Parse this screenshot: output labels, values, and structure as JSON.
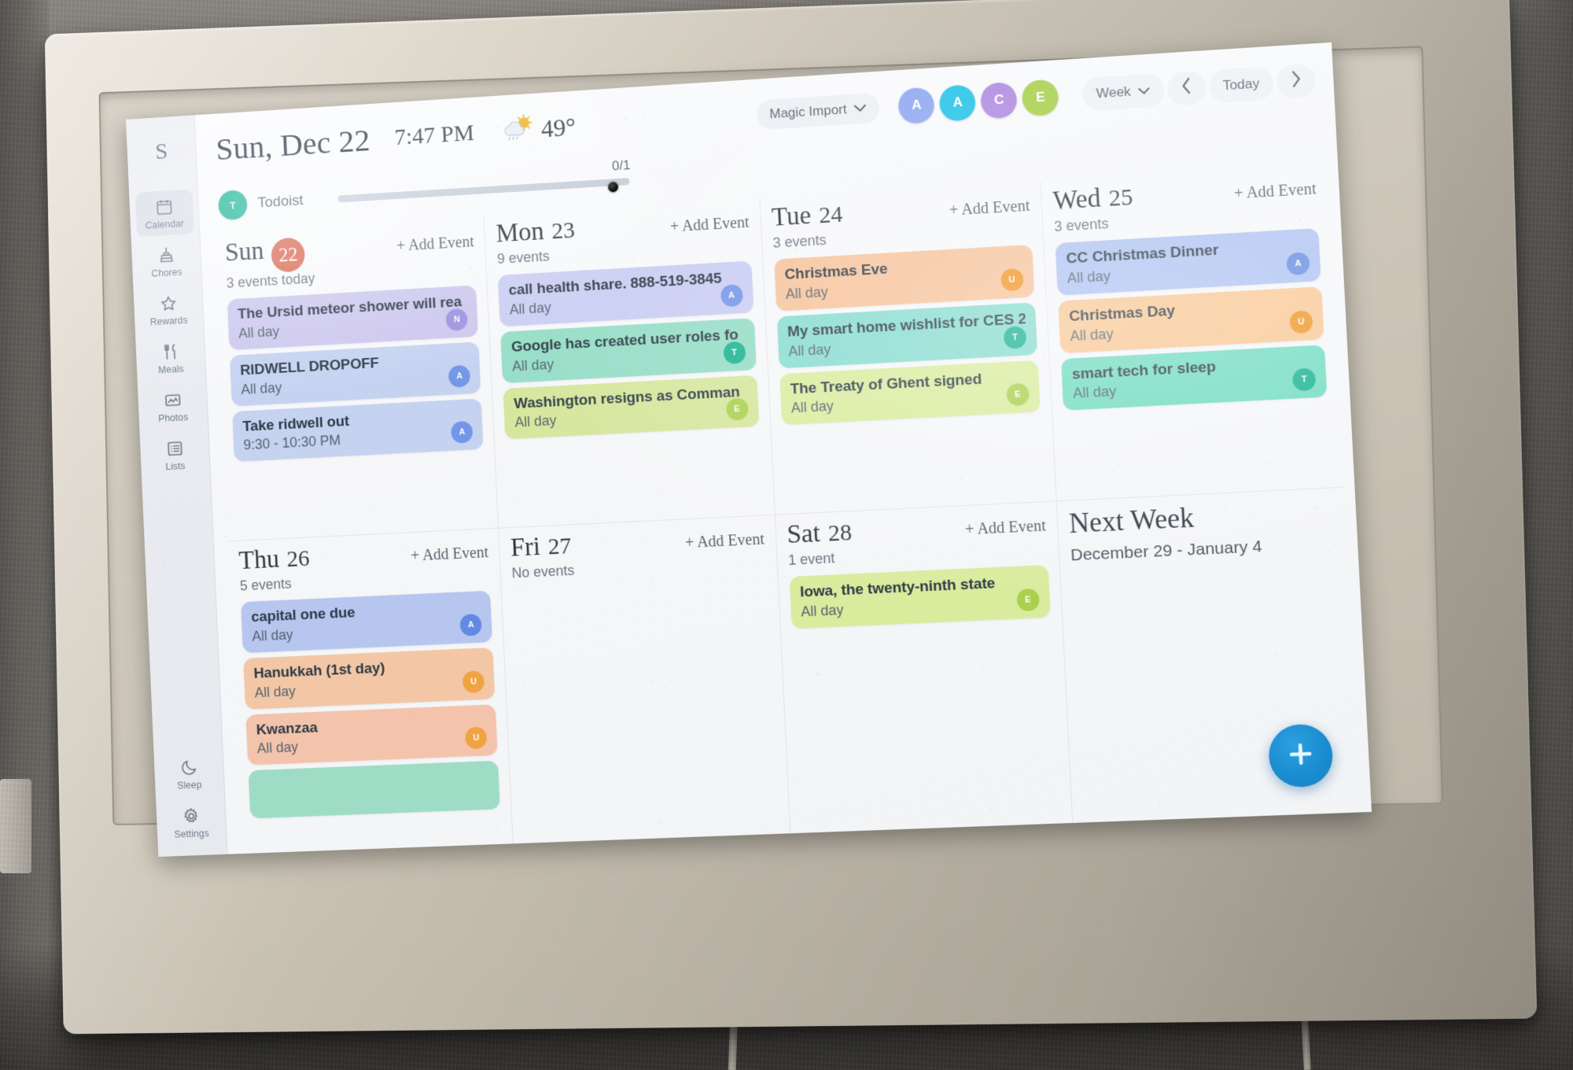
{
  "sidebar": {
    "profile_initial": "S",
    "items": [
      {
        "label": "Calendar",
        "icon": "calendar-icon",
        "active": true
      },
      {
        "label": "Chores",
        "icon": "broom-icon",
        "active": false
      },
      {
        "label": "Rewards",
        "icon": "star-icon",
        "active": false
      },
      {
        "label": "Meals",
        "icon": "utensils-icon",
        "active": false
      },
      {
        "label": "Photos",
        "icon": "photo-icon",
        "active": false
      },
      {
        "label": "Lists",
        "icon": "list-icon",
        "active": false
      },
      {
        "label": "Sleep",
        "icon": "moon-icon",
        "active": false
      },
      {
        "label": "Settings",
        "icon": "gear-icon",
        "active": false
      }
    ]
  },
  "topbar": {
    "date": "Sun, Dec 22",
    "time": "7:47 PM",
    "weather_icon": "partly-cloudy-icon",
    "temperature": "49°",
    "magic_import": "Magic Import",
    "avatars": [
      {
        "initial": "A",
        "color": "#8fa8f0"
      },
      {
        "initial": "A",
        "color": "#25c3e8"
      },
      {
        "initial": "C",
        "color": "#b08ae0"
      },
      {
        "initial": "E",
        "color": "#a8cf4a"
      }
    ],
    "view_label": "Week",
    "prev_label": "‹",
    "today_label": "Today",
    "next_label": "›"
  },
  "todoist": {
    "avatar_initial": "T",
    "avatar_color": "#17b394",
    "name": "Todoist",
    "progress_text": "0/1",
    "progress_value": 0,
    "progress_max": 1
  },
  "days": [
    {
      "name": "Sun",
      "num": "22",
      "is_today": true,
      "add_event": "+ Add Event",
      "count_text": "3 events today",
      "events": [
        {
          "title": "The Ursid meteor shower will rea",
          "time": "All day",
          "bg": "#ccc7ee",
          "avatar": "N",
          "avatar_color": "#9b8fe0"
        },
        {
          "title": "RIDWELL DROPOFF",
          "time": "All day",
          "bg": "#c5d2f0",
          "avatar": "A",
          "avatar_color": "#6f93e8"
        },
        {
          "title": "Take ridwell out",
          "time": "9:30 - 10:30 PM",
          "bg": "#c5d2f0",
          "avatar": "A",
          "avatar_color": "#6f93e8"
        }
      ]
    },
    {
      "name": "Mon",
      "num": "23",
      "is_today": false,
      "add_event": "+ Add Event",
      "count_text": "9 events",
      "events": [
        {
          "title": "call health share. 888-519-3845",
          "time": "All day",
          "bg": "#c9cdf2",
          "avatar": "A",
          "avatar_color": "#6f93e8"
        },
        {
          "title": "Google has created user roles fo",
          "time": "All day",
          "bg": "#95ddc6",
          "avatar": "T",
          "avatar_color": "#13b08e"
        },
        {
          "title": "Washington resigns as Comman",
          "time": "All day",
          "bg": "#d5e69b",
          "avatar": "E",
          "avatar_color": "#a8cf4a"
        }
      ]
    },
    {
      "name": "Tue",
      "num": "24",
      "is_today": false,
      "add_event": "+ Add Event",
      "count_text": "3 events",
      "events": [
        {
          "title": "Christmas Eve",
          "time": "All day",
          "bg": "#f6c39b",
          "avatar": "U",
          "avatar_color": "#f0921e"
        },
        {
          "title": "My smart home wishlist for CES 2",
          "time": "All day",
          "bg": "#87dcd0",
          "avatar": "T",
          "avatar_color": "#13b08e"
        },
        {
          "title": "The Treaty of Ghent signed",
          "time": "All day",
          "bg": "#d9ec9e",
          "avatar": "E",
          "avatar_color": "#a8cf4a"
        }
      ]
    },
    {
      "name": "Wed",
      "num": "25",
      "is_today": false,
      "add_event": "+ Add Event",
      "count_text": "3 events",
      "events": [
        {
          "title": "CC Christmas Dinner",
          "time": "All day",
          "bg": "#adc2f2",
          "avatar": "A",
          "avatar_color": "#5f86e0"
        },
        {
          "title": "Christmas Day",
          "time": "All day",
          "bg": "#f8c793",
          "avatar": "U",
          "avatar_color": "#f0921e"
        },
        {
          "title": "smart tech for sleep",
          "time": "All day",
          "bg": "#72dcc0",
          "avatar": "T",
          "avatar_color": "#13b08e"
        }
      ]
    },
    {
      "name": "Thu",
      "num": "26",
      "is_today": false,
      "add_event": "+ Add Event",
      "count_text": "5 events",
      "events": [
        {
          "title": "capital one due",
          "time": "All day",
          "bg": "#b6c6ef",
          "avatar": "A",
          "avatar_color": "#5f86e0"
        },
        {
          "title": "Hanukkah (1st day)",
          "time": "All day",
          "bg": "#f3c7a6",
          "avatar": "U",
          "avatar_color": "#f0a23e"
        },
        {
          "title": "Kwanzaa",
          "time": "All day",
          "bg": "#f4c3ab",
          "avatar": "U",
          "avatar_color": "#f0a23e"
        },
        {
          "title": "",
          "time": "",
          "bg": "#9fdcc6",
          "avatar": "",
          "avatar_color": "#13b08e"
        }
      ]
    },
    {
      "name": "Fri",
      "num": "27",
      "is_today": false,
      "add_event": "+ Add Event",
      "count_text": "No events",
      "events": []
    },
    {
      "name": "Sat",
      "num": "28",
      "is_today": false,
      "add_event": "+ Add Event",
      "count_text": "1 event",
      "events": [
        {
          "title": "Iowa, the twenty-ninth state",
          "time": "All day",
          "bg": "#d9ec9e",
          "avatar": "E",
          "avatar_color": "#a8cf4a"
        }
      ]
    }
  ],
  "next_week": {
    "title": "Next Week",
    "range": "December 29 - January 4"
  },
  "fab": {
    "icon": "plus-icon"
  }
}
